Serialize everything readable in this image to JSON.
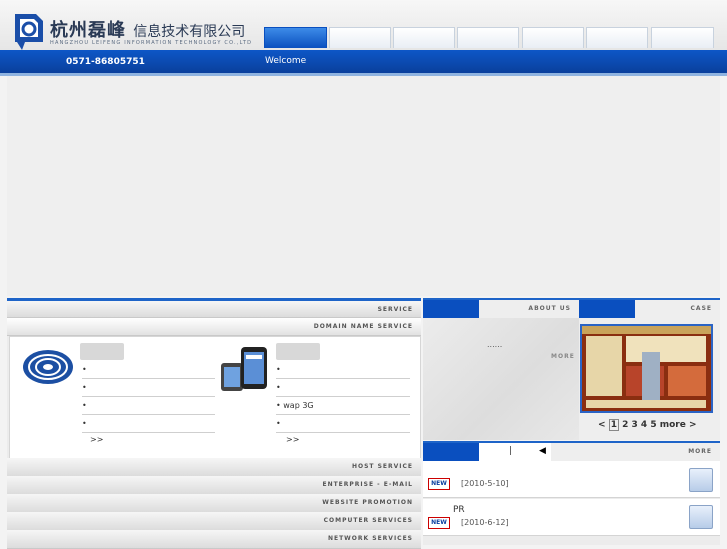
{
  "header": {
    "company_cn": "杭州磊峰",
    "company_cn_sub": "信息技术有限公司",
    "company_en": "HANGZHOU LEIFENG INFORMATION TECHNOLOGY CO.,LTD",
    "phone": "0571-86805751",
    "welcome": "Welcome",
    "tabs": [
      "",
      "",
      "",
      "",
      "",
      "",
      ""
    ]
  },
  "service": {
    "title": "SERVICE",
    "domain_label": "DOMAIN NAME SERVICE",
    "left": {
      "items": [
        "•",
        "•",
        "•",
        "•"
      ],
      "more": ">>"
    },
    "right": {
      "items": [
        "•",
        "•",
        "• wap 3G",
        "•"
      ],
      "more": ">>"
    },
    "strips": [
      "HOST SERVICE",
      "ENTERPRISE - E-MAIL",
      "WEBSITE PROMOTION",
      "COMPUTER SERVICES",
      "NETWORK SERVICES"
    ]
  },
  "about": {
    "title": "ABOUT US",
    "text": "......",
    "more": "MORE"
  },
  "case": {
    "title": "CASE",
    "pages": [
      "<",
      "1",
      "2",
      "3",
      "4",
      "5",
      "more >"
    ]
  },
  "news": {
    "title": "MORE",
    "tab_separator": "|",
    "items": [
      {
        "badge": "NEW",
        "title": "",
        "date": "[2010-5-10]"
      },
      {
        "badge": "NEW",
        "title": "PR",
        "date": "[2010-6-12]"
      }
    ]
  },
  "colors": {
    "brand_blue": "#0a4fbf",
    "accent_blue": "#1e64c8"
  }
}
